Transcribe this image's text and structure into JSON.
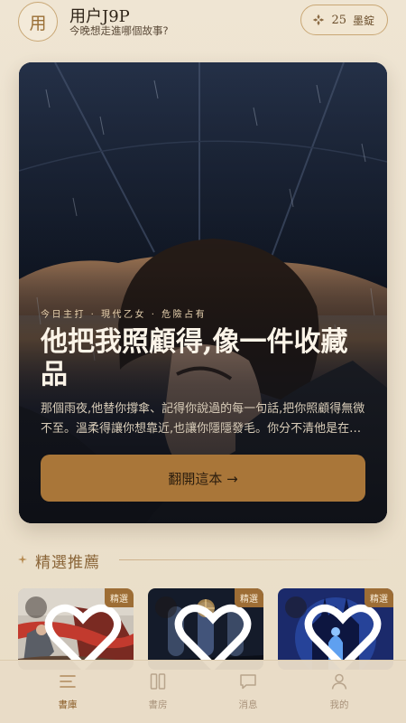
{
  "header": {
    "avatar_char": "用",
    "username": "用户J9P",
    "greeting": "今晚想走進哪個故事?",
    "coins": {
      "amount": "25",
      "unit": "墨錠",
      "icon": "ink-cluster-icon"
    }
  },
  "hero": {
    "tags": "今日主打 · 現代乙女 · 危險占有",
    "title": "他把我照顧得,像一件收藏品",
    "description": "那個雨夜,他替你撐傘、記得你說過的每一句話,把你照顧得無微不至。溫柔得讓你想靠近,也讓你隱隱發毛。你分不清他是在愛你,還是在收藏你。",
    "cta": "翻開這本 →"
  },
  "section": {
    "title": "精選推薦"
  },
  "cards": [
    {
      "badge": "精選",
      "fav_icon": "heart-icon"
    },
    {
      "badge": "精選",
      "fav_icon": "heart-icon"
    },
    {
      "badge": "精選",
      "fav_icon": "heart-icon"
    }
  ],
  "nav": [
    {
      "label": "書庫",
      "icon": "library-icon",
      "active": true
    },
    {
      "label": "書房",
      "icon": "book-icon",
      "active": false
    },
    {
      "label": "消息",
      "icon": "chat-icon",
      "active": false
    },
    {
      "label": "我的",
      "icon": "user-icon",
      "active": false
    }
  ],
  "colors": {
    "accent": "#a97639",
    "active_nav": "#8a5c27",
    "background": "#ece1cd"
  }
}
